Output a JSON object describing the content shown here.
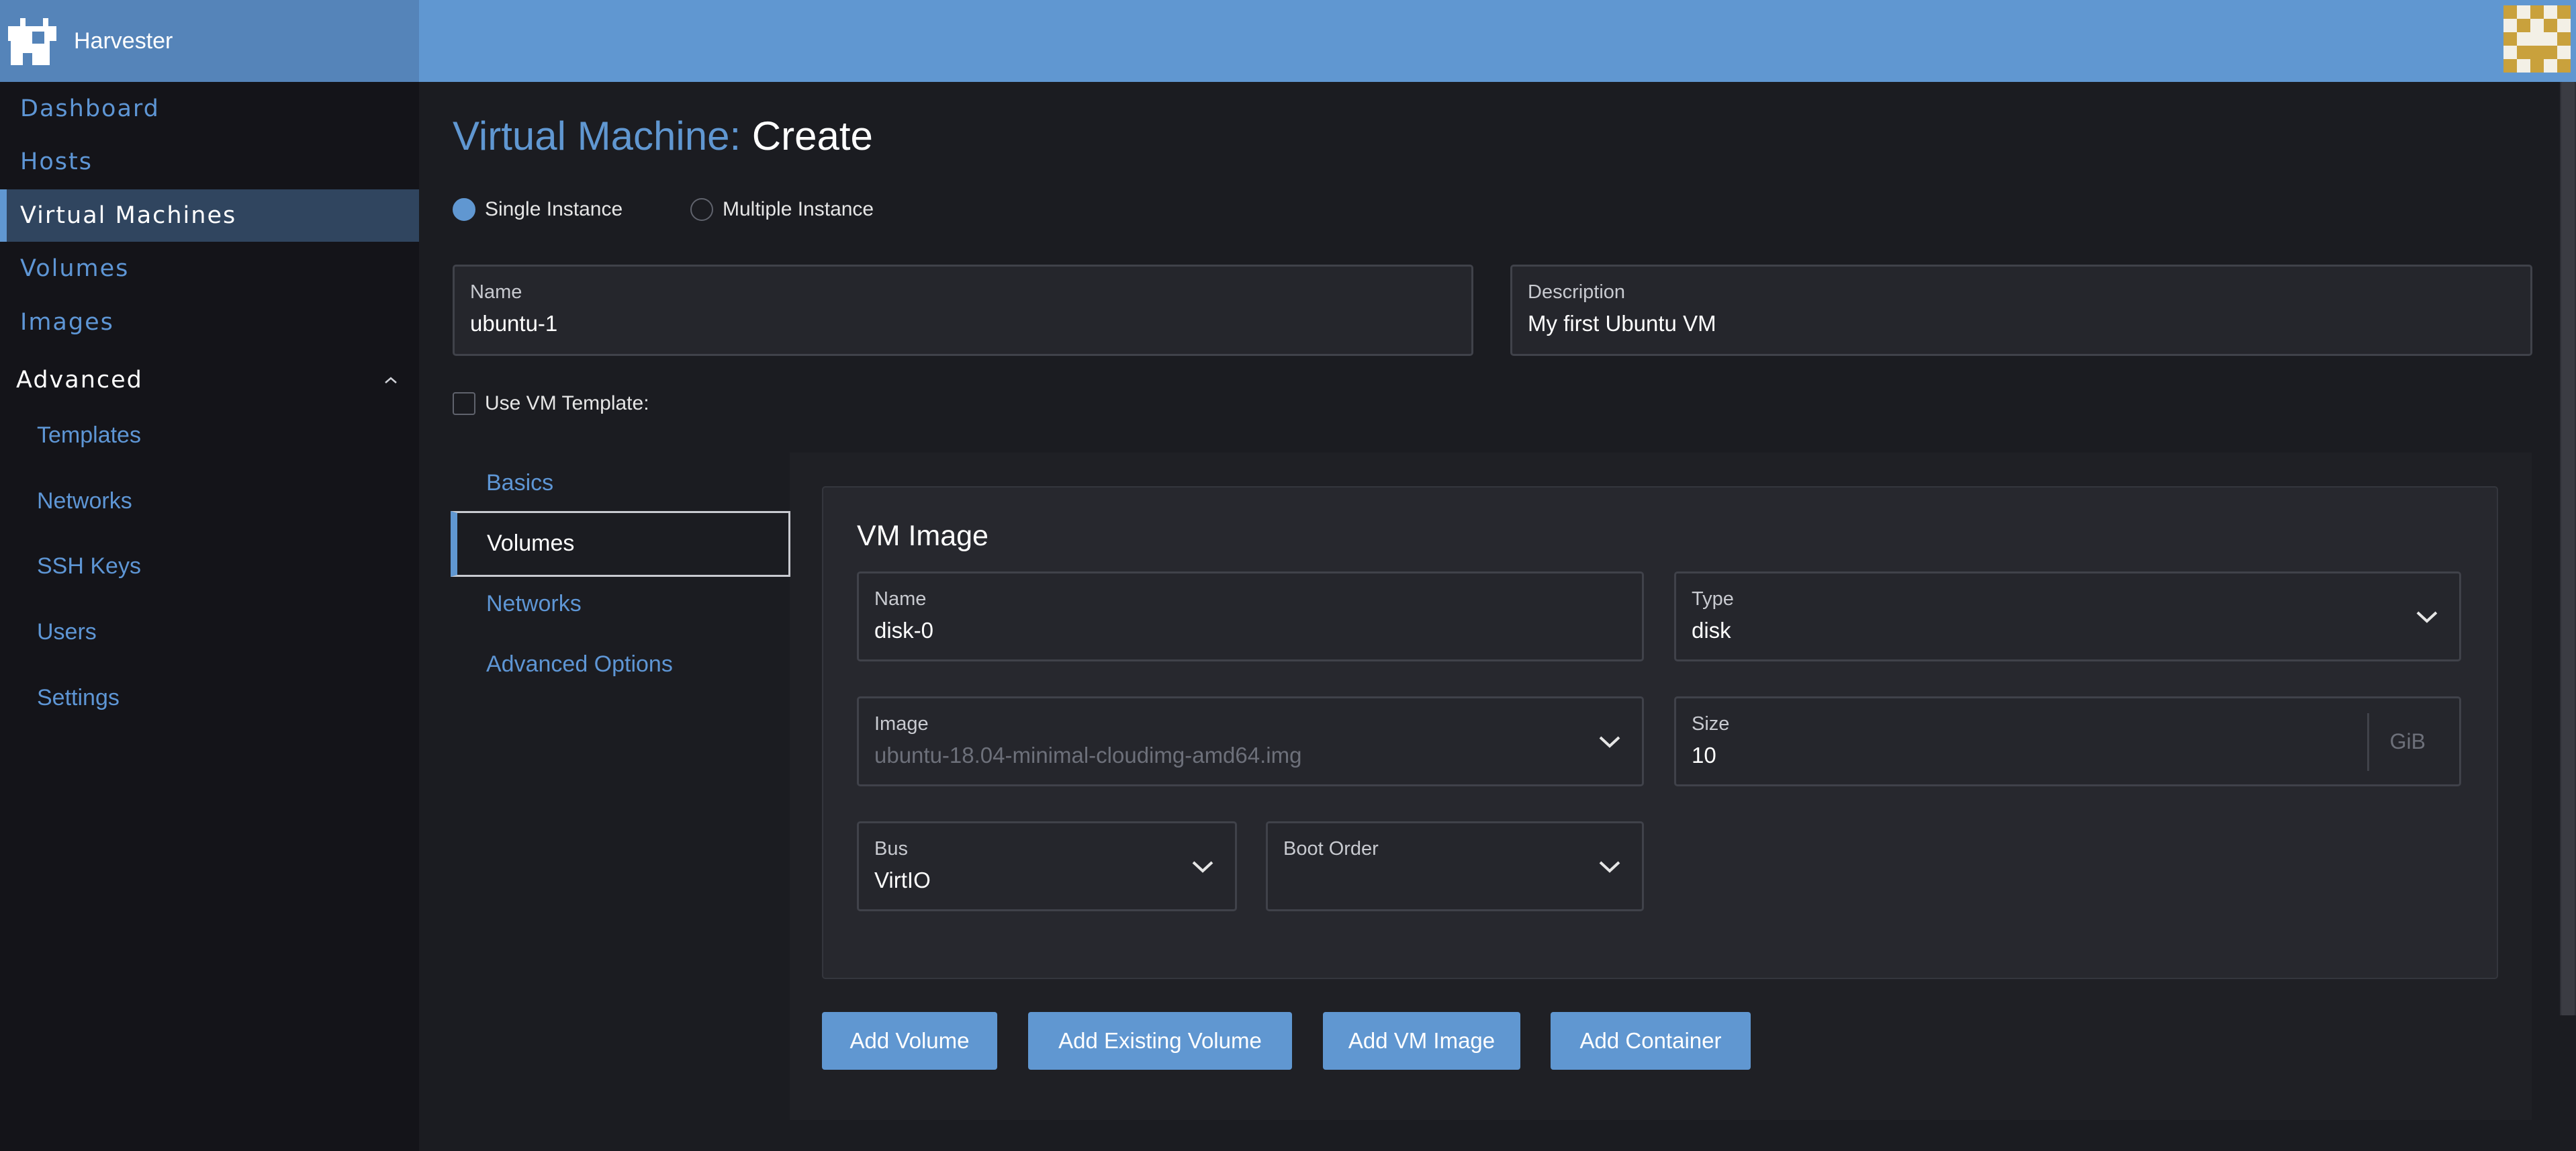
{
  "app": {
    "name": "Harvester"
  },
  "sidebar": {
    "items": [
      {
        "label": "Dashboard"
      },
      {
        "label": "Hosts"
      },
      {
        "label": "Virtual Machines",
        "active": true
      },
      {
        "label": "Volumes"
      },
      {
        "label": "Images"
      }
    ],
    "group": {
      "label": "Advanced",
      "expanded": true,
      "items": [
        {
          "label": "Templates"
        },
        {
          "label": "Networks"
        },
        {
          "label": "SSH Keys"
        },
        {
          "label": "Users"
        },
        {
          "label": "Settings"
        }
      ]
    }
  },
  "page": {
    "title_prefix": "Virtual Machine:",
    "title_action": "Create"
  },
  "instance_mode": {
    "options": [
      {
        "label": "Single Instance",
        "checked": true
      },
      {
        "label": "Multiple Instance",
        "checked": false
      }
    ]
  },
  "form": {
    "name": {
      "label": "Name",
      "value": "ubuntu-1"
    },
    "description": {
      "label": "Description",
      "value": "My first Ubuntu VM"
    },
    "use_template": {
      "label": "Use VM Template:",
      "checked": false
    }
  },
  "tabs": [
    {
      "label": "Basics"
    },
    {
      "label": "Volumes",
      "active": true
    },
    {
      "label": "Networks"
    },
    {
      "label": "Advanced Options"
    }
  ],
  "volume": {
    "title": "VM Image",
    "name": {
      "label": "Name",
      "value": "disk-0"
    },
    "type": {
      "label": "Type",
      "value": "disk"
    },
    "image": {
      "label": "Image",
      "value": "ubuntu-18.04-minimal-cloudimg-amd64.img"
    },
    "size": {
      "label": "Size",
      "value": "10",
      "unit": "GiB"
    },
    "bus": {
      "label": "Bus",
      "value": "VirtIO"
    },
    "boot_order": {
      "label": "Boot Order",
      "value": ""
    }
  },
  "actions": [
    {
      "label": "Add Volume"
    },
    {
      "label": "Add Existing Volume"
    },
    {
      "label": "Add VM Image"
    },
    {
      "label": "Add Container"
    }
  ],
  "colors": {
    "accent": "#6097d1",
    "header": "#6097d1",
    "sidebar_bg": "#141419",
    "page_bg": "#1b1c21",
    "card_bg": "#27282e"
  },
  "icons": {
    "brand": "harvester-logo-icon",
    "avatar": "identicon-avatar",
    "dropdown": "chevron-down-icon",
    "group_toggle": "chevron-up-icon"
  }
}
